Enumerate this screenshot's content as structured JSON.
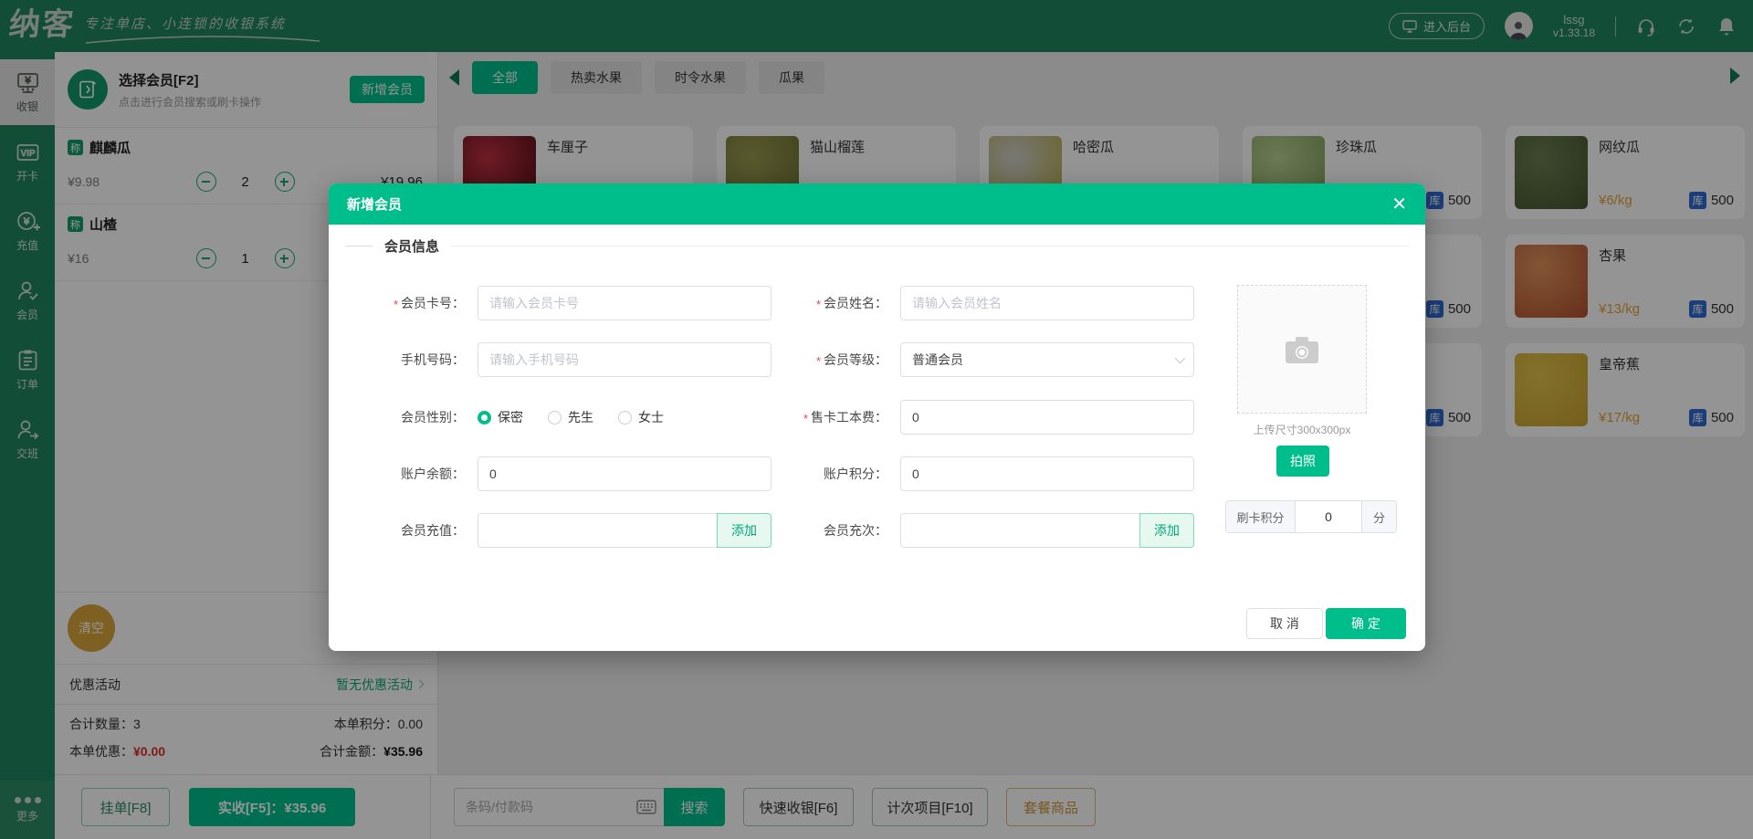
{
  "colors": {
    "brand": "#00BE8C",
    "topbar_green": "#20865F",
    "price_orange": "#E6A23C",
    "stock_blue": "#2B6BD0",
    "alert_red": "#E02B2B",
    "clear_gold": "#D9A63C"
  },
  "topbar": {
    "logo": "纳客",
    "slogan": "专注单店、小连锁的收银系统",
    "backstage": "进入后台",
    "user": "lssg",
    "version": "v1.33.18"
  },
  "sidebar": {
    "items": [
      {
        "key": "cashier",
        "label": "收银",
        "icon_text": "¥",
        "active": true
      },
      {
        "key": "open-card",
        "label": "开卡",
        "icon_text": "VIP",
        "active": false
      },
      {
        "key": "recharge",
        "label": "充值",
        "icon_text": "¥",
        "active": false
      },
      {
        "key": "member",
        "label": "会员",
        "icon_text": "",
        "active": false
      },
      {
        "key": "orders",
        "label": "订单",
        "icon_text": "",
        "active": false
      },
      {
        "key": "shift",
        "label": "交班",
        "icon_text": "",
        "active": false
      }
    ],
    "more": "更多"
  },
  "member_panel": {
    "title": "选择会员[F2]",
    "subtitle": "点击进行会员搜索或刷卡操作",
    "add_button": "新增会员"
  },
  "cart": {
    "items": [
      {
        "badge": "称",
        "name": "麒麟瓜",
        "price": "¥9.98",
        "qty": "2",
        "total": "¥19.96"
      },
      {
        "badge": "称",
        "name": "山楂",
        "price": "¥16",
        "qty": "1",
        "total": ""
      }
    ]
  },
  "summary": {
    "clear": "清空",
    "promo_label": "优惠活动",
    "promo_value": "暂无优惠活动",
    "qty_label": "合计数量：",
    "qty_value": "3",
    "points_label": "本单积分：",
    "points_value": "0.00",
    "discount_label": "本单优惠：",
    "discount_value": "¥0.00",
    "total_label": "合计金额：",
    "total_value": "¥35.96"
  },
  "bottom_bar": {
    "hold": "挂单[F8]",
    "pay": "实收[F5]：¥35.96",
    "search_placeholder": "条码/付款码",
    "search": "搜索",
    "quick": "快速收银[F6]",
    "count_item": "计次项目[F10]",
    "combo": "套餐商品"
  },
  "categories": {
    "tabs": [
      {
        "label": "全部",
        "active": true
      },
      {
        "label": "热卖水果",
        "active": false
      },
      {
        "label": "时令水果",
        "active": false
      },
      {
        "label": "瓜果",
        "active": false
      }
    ]
  },
  "products": {
    "stock_badge": "库",
    "grid": [
      {
        "name": "车厘子",
        "price": "",
        "stock": "",
        "img": [
          "#c03040",
          "#4a0d12"
        ]
      },
      {
        "name": "猫山榴莲",
        "price": "",
        "stock": "",
        "img": [
          "#9a9a50",
          "#6b7030"
        ]
      },
      {
        "name": "哈密瓜",
        "price": "",
        "stock": "",
        "img": [
          "#cfcfcb",
          "#b5a93e"
        ]
      },
      {
        "name": "珍珠瓜",
        "price": "",
        "stock": "500",
        "img": [
          "#b9d295",
          "#7d9e55"
        ]
      },
      {
        "name": "网纹瓜",
        "price": "¥6/kg",
        "stock": "500",
        "img": [
          "#6d7f50",
          "#46552f"
        ]
      },
      {
        "name": "",
        "price": "",
        "stock": "",
        "img": []
      },
      {
        "name": "",
        "price": "",
        "stock": "",
        "img": []
      },
      {
        "name": "",
        "price": "",
        "stock": "",
        "img": []
      },
      {
        "name": "",
        "price": "",
        "stock": "500",
        "img": [
          "#e0955c",
          "#b2502f"
        ]
      },
      {
        "name": "杏果",
        "price": "¥13/kg",
        "stock": "500",
        "img": [
          "#e0955c",
          "#b2502f"
        ]
      },
      {
        "name": "",
        "price": "",
        "stock": "",
        "img": []
      },
      {
        "name": "",
        "price": "",
        "stock": "",
        "img": []
      },
      {
        "name": "",
        "price": "",
        "stock": "",
        "img": []
      },
      {
        "name": "",
        "price": "",
        "stock": "500",
        "img": [
          "#e3c34d",
          "#c7a42e"
        ]
      },
      {
        "name": "皇帝蕉",
        "price": "¥17/kg",
        "stock": "500",
        "img": [
          "#e3c34d",
          "#c7a42e"
        ]
      }
    ]
  },
  "modal": {
    "title": "新增会员",
    "section": "会员信息",
    "card_no": {
      "label": "会员卡号：",
      "placeholder": "请输入会员卡号"
    },
    "name": {
      "label": "会员姓名：",
      "placeholder": "请输入会员姓名"
    },
    "phone": {
      "label": "手机号码：",
      "placeholder": "请输入手机号码"
    },
    "level": {
      "label": "会员等级：",
      "value": "普通会员"
    },
    "gender": {
      "label": "会员性别：",
      "options": [
        {
          "label": "保密",
          "selected": true
        },
        {
          "label": "先生",
          "selected": false
        },
        {
          "label": "女士",
          "selected": false
        }
      ]
    },
    "card_fee": {
      "label": "售卡工本费：",
      "value": "0"
    },
    "balance": {
      "label": "账户余额：",
      "value": "0"
    },
    "points": {
      "label": "账户积分：",
      "value": "0"
    },
    "recharge": {
      "label": "会员充值：",
      "add": "添加"
    },
    "times": {
      "label": "会员充次：",
      "add": "添加"
    },
    "upload_hint": "上传尺寸300x300px",
    "photo_button": "拍照",
    "swipe": {
      "label": "刷卡积分",
      "value": "0",
      "unit": "分"
    },
    "cancel": "取 消",
    "confirm": "确 定"
  }
}
